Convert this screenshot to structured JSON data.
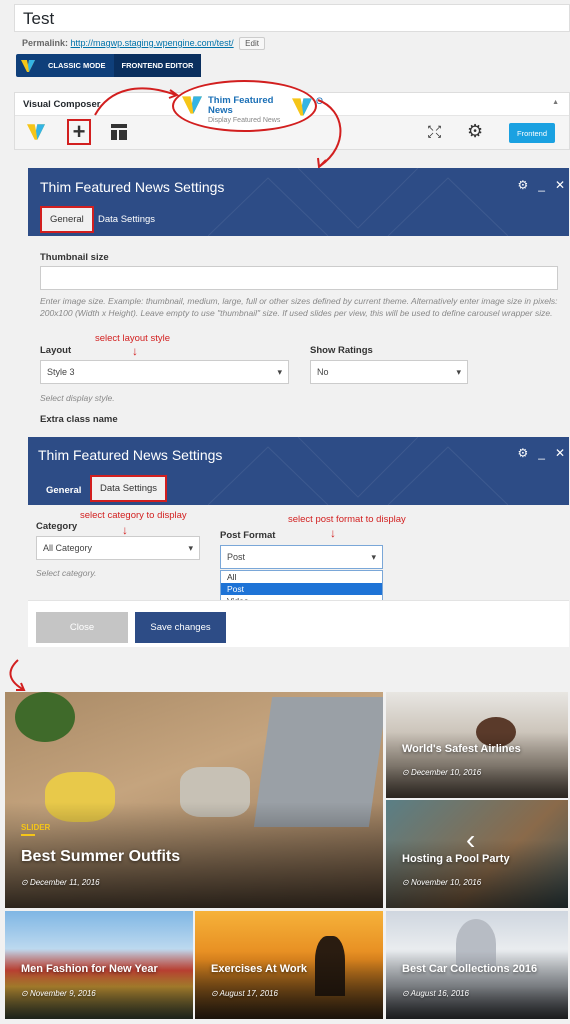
{
  "editor": {
    "title_value": "Test",
    "permalink_label": "Permalink:",
    "permalink_url": "http://magwp.staging.wpengine.com/test/",
    "edit_label": "Edit",
    "classic_mode": "CLASSIC MODE",
    "frontend_editor": "FRONTEND EDITOR"
  },
  "vc": {
    "title": "Visual Composer",
    "frontend_button": "Frontend",
    "callout_title": "Thim Featured News",
    "callout_desc": "Display Featured News",
    "callout_partial_text": "O"
  },
  "dialog1": {
    "title": "Thim Featured News Settings",
    "tabs": [
      "General",
      "Data Settings"
    ],
    "thumbnail_label": "Thumbnail size",
    "thumbnail_help": "Enter image size. Example: thumbnail, medium, large, full or other sizes defined by current theme. Alternatively enter image size in pixels: 200x100 (Width x Height). Leave empty to use \"thumbnail\" size. If used slides per view, this will be used to define carousel wrapper size.",
    "layout_label": "Layout",
    "layout_note": "select layout style",
    "layout_value": "Style 3",
    "layout_help": "Select display style.",
    "ratings_label": "Show Ratings",
    "ratings_value": "No",
    "extra_label": "Extra class name"
  },
  "dialog2": {
    "title": "Thim Featured News Settings",
    "tabs": [
      "General",
      "Data Settings"
    ],
    "category_label": "Category",
    "category_note": "select category to display",
    "category_value": "All Category",
    "category_help": "Select category.",
    "format_label": "Post Format",
    "format_note": "select post format to display",
    "format_value": "Post",
    "format_options": [
      "All",
      "Post",
      "Video"
    ],
    "close_label": "Close",
    "save_label": "Save changes"
  },
  "posts": {
    "main": {
      "category": "SLIDER",
      "title": "Best Summer Outfits",
      "date": "December 11, 2016"
    },
    "side1": {
      "title": "World's Safest Airlines",
      "date": "December 10, 2016"
    },
    "side2": {
      "title": "Hosting a Pool Party",
      "date": "November 10, 2016"
    },
    "bottom1": {
      "title": "Men Fashion for New Year",
      "date": "November 9, 2016"
    },
    "bottom2": {
      "title": "Exercises At Work",
      "date": "August 17, 2016"
    },
    "bottom3": {
      "title": "Best Car Collections 2016",
      "date": "August 16, 2016"
    }
  },
  "colors": {
    "accent": "#2d4c86",
    "annotation": "#d21f1f",
    "frontend": "#1aa1e1",
    "category_badge": "#f5c518"
  }
}
